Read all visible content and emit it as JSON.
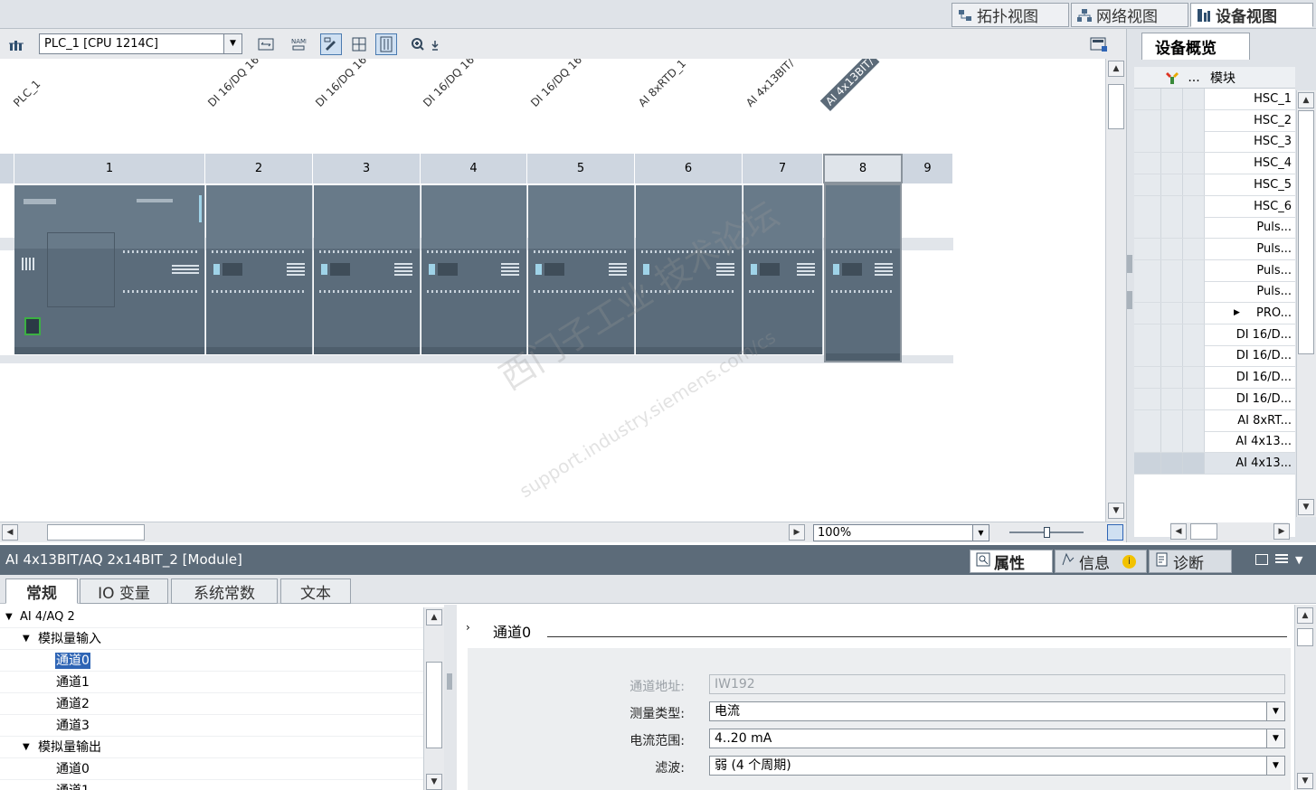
{
  "view_tabs": [
    {
      "label": "拓扑视图",
      "icon": "topology-view-icon"
    },
    {
      "label": "网络视图",
      "icon": "network-view-icon"
    },
    {
      "label": "设备视图",
      "icon": "device-view-icon",
      "active": true
    }
  ],
  "toolbar": {
    "device_select": "PLC_1 [CPU 1214C]",
    "zoom_value": "100%"
  },
  "rack": {
    "device_labels": [
      "PLC_1",
      "DI 16/DQ 16",
      "DI 16/DQ 16",
      "DI 16/DQ 16",
      "DI 16/DQ 16",
      "AI 8xRTD_1",
      "AI 4x13BIT/",
      "AI 4x13BIT/"
    ],
    "slots": [
      "1",
      "2",
      "3",
      "4",
      "5",
      "6",
      "7",
      "8",
      "9"
    ],
    "selected_slot": "8"
  },
  "watermark": {
    "line1": "西门子工业  技术论坛",
    "line2": "support.industry.siemens.com/cs"
  },
  "overview": {
    "tab_label": "设备概览",
    "column_module": "模块",
    "column_dots": "...",
    "rows": [
      "HSC_1",
      "HSC_2",
      "HSC_3",
      "HSC_4",
      "HSC_5",
      "HSC_6",
      "Puls...",
      "Puls...",
      "Puls...",
      "Puls...",
      "PRO...",
      "DI 16/D...",
      "DI 16/D...",
      "DI 16/D...",
      "DI 16/D...",
      "AI 8xRT...",
      "AI 4x13...",
      "AI 4x13..."
    ],
    "expand_row": "PRO...",
    "selected_row": 17
  },
  "module_bar": {
    "title": "AI 4x13BIT/AQ 2x14BIT_2 [Module]",
    "tabs": [
      {
        "label": "属性",
        "icon": "properties-icon",
        "active": true
      },
      {
        "label": "信息",
        "icon": "info-icon"
      },
      {
        "label": "诊断",
        "icon": "diagnostics-icon"
      }
    ]
  },
  "sub_tabs": [
    "常规",
    "IO 变量",
    "系统常数",
    "文本"
  ],
  "tree": {
    "root": "AI 4/AQ 2",
    "groups": [
      {
        "label": "模拟量输入",
        "children": [
          "通道0",
          "通道1",
          "通道2",
          "通道3"
        ]
      },
      {
        "label": "模拟量输出",
        "children": [
          "通道0",
          "通道1"
        ]
      }
    ],
    "selected": "通道0"
  },
  "detail": {
    "section_title": "通道0",
    "fields": [
      {
        "label": "通道地址:",
        "value": "IW192",
        "disabled": true
      },
      {
        "label": "测量类型:",
        "value": "电流"
      },
      {
        "label": "电流范围:",
        "value": "4..20 mA"
      },
      {
        "label": "滤波:",
        "value": "弱 (4 个周期)"
      }
    ]
  }
}
